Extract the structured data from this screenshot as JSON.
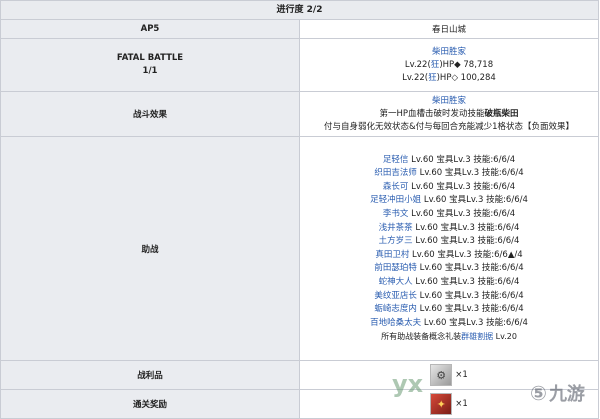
{
  "progress": "进行度 2/2",
  "ap": {
    "label": "AP5",
    "location": "春日山城"
  },
  "fatal": {
    "label_line1": "FATAL BATTLE",
    "label_line2": "1/1",
    "enemy_name": "柴田胜家",
    "hp_lines": [
      {
        "level_prefix": "Lv.22(",
        "class": "狂",
        "rest": ")HP◆ 78,718"
      },
      {
        "level_prefix": "Lv.22(",
        "class": "狂",
        "rest": ")HP◇ 100,284"
      }
    ]
  },
  "effect": {
    "label": "战斗效果",
    "name": "柴田胜家",
    "line2_prefix": "第一HP血槽击破时发动技能",
    "line2_skill": "破瓶柴田",
    "line3": "付与自身弱化无效状态&付与每回合充能减少1格状态【负面效果】"
  },
  "support": {
    "label": "助战",
    "rows": [
      {
        "name": "足轻信",
        "stats": " Lv.60 宝具Lv.3 技能:6/6/4"
      },
      {
        "name": "织田吉法师",
        "stats": " Lv.60 宝具Lv.3 技能:6/6/4"
      },
      {
        "name": "森长可",
        "stats": " Lv.60 宝具Lv.3 技能:6/6/4"
      },
      {
        "name": "足轻冲田小姐",
        "stats": " Lv.60 宝具Lv.3 技能:6/6/4"
      },
      {
        "name": "李书文",
        "stats": " Lv.60 宝具Lv.3 技能:6/6/4"
      },
      {
        "name": "浅井茶茶",
        "stats": " Lv.60 宝具Lv.3 技能:6/6/4"
      },
      {
        "name": "土方岁三",
        "stats": " Lv.60 宝具Lv.3 技能:6/6/4"
      },
      {
        "name": "真田卫村",
        "stats": " Lv.60 宝具Lv.3 技能:6/6▲/4"
      },
      {
        "name": "前田瑟珀特",
        "stats": " Lv.60 宝具Lv.3 技能:6/6/4"
      },
      {
        "name": "蛇神大人",
        "stats": " Lv.60 宝具Lv.3 技能:6/6/4"
      },
      {
        "name": "美纹亚店长",
        "stats": " Lv.60 宝具Lv.3 技能:6/6/4"
      },
      {
        "name": "蛎崎志度内",
        "stats": " Lv.60 宝具Lv.3 技能:6/6/4"
      },
      {
        "name": "百地哈桑太夫",
        "stats": " Lv.60 宝具Lv.3 技能:6/6/4"
      }
    ],
    "note_prefix": "所有助战装备概念礼装",
    "note_ce": "群雄割据",
    "note_suffix": " Lv.20"
  },
  "loot": {
    "label": "战利品",
    "count": "×1"
  },
  "reward": {
    "label": "通关奖励",
    "count": "×1"
  },
  "watermarks": {
    "w1": "yx",
    "w2": "九游"
  },
  "colors": {
    "link": "#2a5db0",
    "label_bg": "#eaecf0",
    "border": "#c9ccd4"
  }
}
